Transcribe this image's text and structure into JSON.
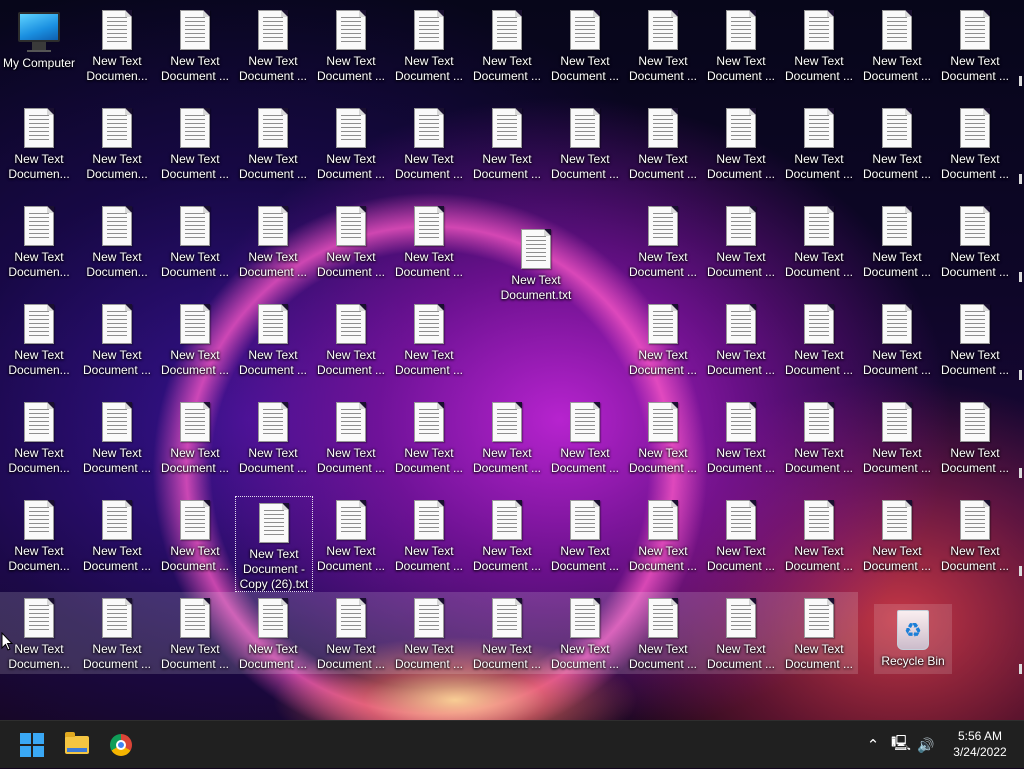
{
  "desktop": {
    "my_computer_label": "My Computer",
    "recycle_bin_label": "Recycle Bin",
    "recycle_symbol": "♻",
    "selected_file_label": "New Text Document - Copy (26).txt",
    "lone_file_label": "New Text Document.txt",
    "label_a": "New Text Documen...",
    "label_b": "New Text Document ..."
  },
  "taskbar": {
    "time": "5:56 AM",
    "date": "3/24/2022",
    "chevron_up_glyph": "⌃",
    "network_glyph": "🖳",
    "volume_glyph": "🔊",
    "start_color": "#3aa8f5"
  }
}
